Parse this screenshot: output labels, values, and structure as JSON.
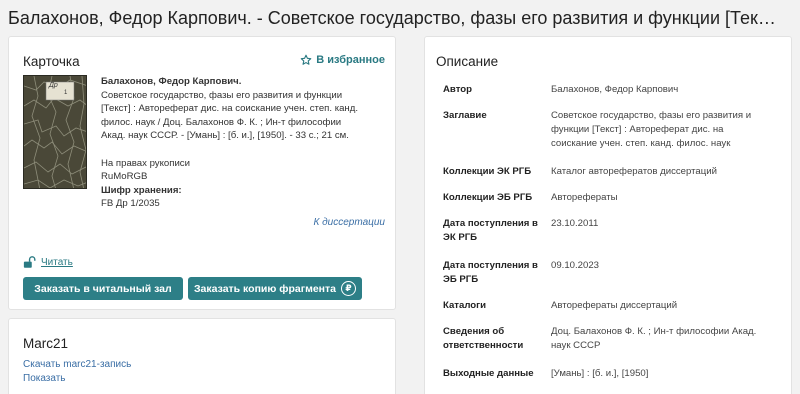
{
  "page": {
    "title": "Балахонов, Федор Карпович. - Советское государство, фазы его развития и функции [Тек…"
  },
  "card": {
    "title": "Карточка",
    "favorite_label": "В избранное",
    "author": "Балахонов, Федор Карпович.",
    "description_lines": [
      "Советское государство, фазы его развития и функции",
      "[Текст] : Автореферат дис. на соискание учен. степ. канд.",
      "филос. наук / Доц. Балахонов Ф. К. ; Ин-т философии",
      "Акад. наук СССР. - [Умань] : [б. и.], [1950]. - 33 с.; 21 см."
    ],
    "rights_note": "На правах рукописи",
    "library_code": "RuMoRGB",
    "shelfmark_label": "Шифр хранения:",
    "shelfmark_value": "FB Др 1/2035",
    "dissertation_link": "К диссертации",
    "read_link": "Читать",
    "order_reading_room": "Заказать в читальный зал",
    "order_copy": "Заказать копию фрагмента",
    "ruble_symbol": "₽",
    "thumb_label_line1": "Др",
    "thumb_label_line2": "1"
  },
  "marc": {
    "title": "Marc21",
    "download_link": "Скачать marc21-запись",
    "show_link": "Показать"
  },
  "description": {
    "title": "Описание",
    "rows": [
      {
        "key": "Автор",
        "value": "Балахонов, Федор Карпович"
      },
      {
        "key": "Заглавие",
        "value": "Советское государство, фазы его развития и функции [Текст] : Автореферат дис. на соискание учен. степ. канд. филос. наук"
      },
      {
        "key": "Коллекции ЭК РГБ",
        "value": "Каталог авторефератов диссертаций"
      },
      {
        "key": "Коллекции ЭБ РГБ",
        "value": "Авторефераты"
      },
      {
        "key": "Дата поступления в ЭК РГБ",
        "value": "23.10.2011"
      },
      {
        "key": "Дата поступления в ЭБ РГБ",
        "value": "09.10.2023"
      },
      {
        "key": "Каталоги",
        "value": "Авторефераты диссертаций"
      },
      {
        "key": "Сведения об ответственности",
        "value": "Доц. Балахонов Ф. К. ; Ин-т философии Акад. наук СССР"
      },
      {
        "key": "Выходные данные",
        "value": "[Умань] : [б. и.], [1950]"
      }
    ]
  },
  "colors": {
    "accent": "#2d7f87",
    "link": "#3a6ea5"
  },
  "icons": {
    "favorite": "star-outline-icon",
    "read": "open-lock-icon",
    "ruble": "ruble-icon"
  }
}
